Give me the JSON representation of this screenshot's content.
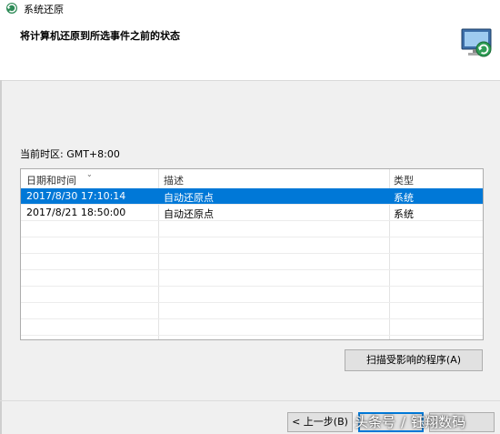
{
  "window": {
    "title": "系统还原"
  },
  "header": {
    "heading": "将计算机还原到所选事件之前的状态"
  },
  "timezone": {
    "label": "当前时区: GMT+8:00"
  },
  "table": {
    "columns": [
      "日期和时间",
      "描述",
      "类型"
    ],
    "rows": [
      {
        "date": "2017/8/30 17:10:14",
        "description": "自动还原点",
        "type": "系统",
        "selected": true
      },
      {
        "date": "2017/8/21 18:50:00",
        "description": "自动还原点",
        "type": "系统",
        "selected": false
      }
    ]
  },
  "buttons": {
    "scan": "扫描受影响的程序(A)",
    "back": "< 上一步(B)",
    "next": "",
    "cancel": ""
  },
  "watermark": {
    "left": "头条号",
    "right": "钰翔数码"
  },
  "colors": {
    "selection": "#0078d7",
    "background": "#f0f0f0"
  },
  "icons": [
    "system-restore-icon",
    "system-restore-large-icon",
    "sort-descending-icon"
  ]
}
